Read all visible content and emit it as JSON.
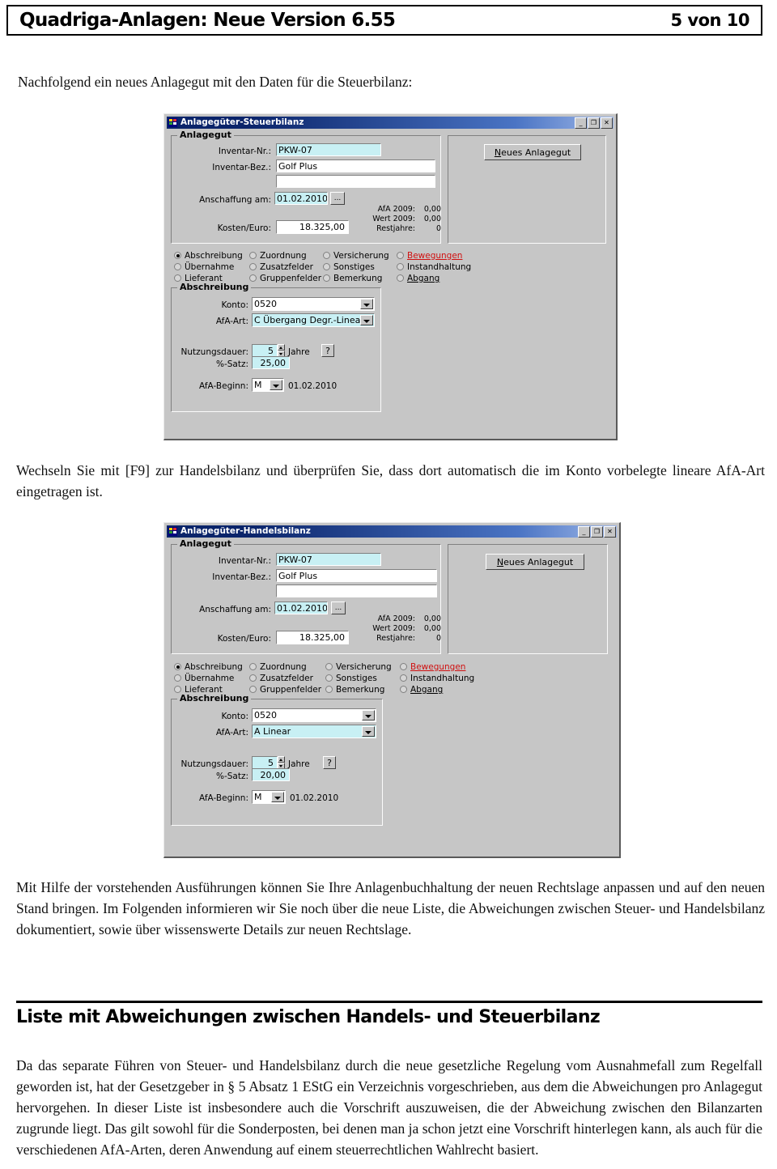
{
  "header": {
    "title": "Quadriga-Anlagen: Neue Version 6.55",
    "page_indicator": "5 von 10"
  },
  "body": {
    "lead_paragraph": "Nachfolgend ein neues Anlagegut mit den Daten für die Steuerbilanz:",
    "middle_paragraph": "Wechseln Sie mit [F9] zur Handelsbilanz und überprüfen Sie, dass dort automatisch die im Konto vorbelegte lineare AfA-Art eingetragen ist.",
    "after_second_paragraph": "Mit Hilfe der vorstehenden Ausführungen können Sie Ihre Anlagenbuchhaltung der neuen Rechtslage anpassen und auf den neuen Stand bringen. Im Folgenden informieren wir Sie noch über die neue Liste, die Abweichungen zwischen Steuer- und Handelsbilanz dokumentiert, sowie über wissenswerte Details zur neuen Rechtslage.",
    "section_heading": "Liste mit Abweichungen zwischen Handels- und Steuerbilanz",
    "last_paragraph": "Da das separate Führen von Steuer- und Handelsbilanz durch die neue gesetzliche Regelung vom Ausnahmefall zum Regelfall geworden ist, hat der Gesetzgeber in § 5 Absatz 1 EStG ein Verzeichnis vorgeschrieben, aus dem die Abweichungen pro Anlagegut hervorgehen. In dieser Liste ist insbesondere auch die Vorschrift auszuweisen, die der Abweichung zwischen den Bilanzarten zugrunde liegt. Das gilt sowohl für die Sonderposten, bei denen man ja schon jetzt eine Vorschrift hinterlegen kann, als auch für die verschiedenen AfA-Arten, deren Anwendung auf einem steuerrechtlichen Wahlrecht basiert."
  },
  "dialog_steuerbilanz": {
    "window_title": "Anlagegüter-Steuerbilanz",
    "titlebar_buttons": {
      "minimize": "_",
      "maximize": "❐",
      "close": "✕"
    },
    "new_asset_button": {
      "underlined": "N",
      "rest": "eues Anlagegut"
    },
    "group_anlagegut": "Anlagegut",
    "fields": {
      "inventar_nr_label": "Inventar-Nr.:",
      "inventar_nr_value": "PKW-07",
      "inventar_bez_label": "Inventar-Bez.:",
      "inventar_bez_value": "Golf Plus",
      "inventar_bez2_value": "",
      "anschaffung_label": "Anschaffung am:",
      "anschaffung_value": "01.02.2010",
      "browse_button": "...",
      "kosten_label": "Kosten/Euro:",
      "kosten_value": "18.325,00"
    },
    "stats": [
      {
        "key": "AfA 2009:",
        "value": "0,00"
      },
      {
        "key": "Wert 2009:",
        "value": "0,00"
      },
      {
        "key": "Restjahre:",
        "value": "0"
      }
    ],
    "radios": [
      {
        "label": "Abschreibung",
        "underline": "A",
        "selected": true,
        "red": false
      },
      {
        "label": "Übernahme",
        "underline": "b",
        "selected": false,
        "red": false
      },
      {
        "label": "Lieferant",
        "underline": "L",
        "selected": false,
        "red": false
      },
      {
        "label": "Zuordnung",
        "underline": "Z",
        "selected": false,
        "red": false
      },
      {
        "label": "Zusatzfelder",
        "underline": "",
        "selected": false,
        "red": false
      },
      {
        "label": "Gruppenfelder",
        "underline": "G",
        "selected": false,
        "red": false
      },
      {
        "label": "Versicherung",
        "underline": "V",
        "selected": false,
        "red": false
      },
      {
        "label": "Sonstiges",
        "underline": "S",
        "selected": false,
        "red": false
      },
      {
        "label": "Bemerkung",
        "underline": "",
        "selected": false,
        "red": false
      },
      {
        "label": "Bewegungen",
        "underline": "Bewegungen",
        "selected": false,
        "red": true
      },
      {
        "label": "Instandhaltung",
        "underline": "h",
        "selected": false,
        "red": false
      },
      {
        "label": "Abgang",
        "underline": "Abgang",
        "selected": false,
        "red": false
      }
    ],
    "group_abschreibung": "Abschreibung",
    "abschreibung": {
      "konto_label": "Konto:",
      "konto_value": "0520",
      "afa_art_label": "AfA-Art:",
      "afa_art_value": "C Übergang Degr.-Linear",
      "nutzungsdauer_label": "Nutzungsdauer:",
      "nutzungsdauer_value": "5",
      "jahre_label": "Jahre",
      "help_button": "?",
      "satz_label": "%-Satz:",
      "satz_value": "25,00",
      "afa_beginn_label": "AfA-Beginn:",
      "afa_beginn_value": "M",
      "afa_beginn_date": "01.02.2010"
    }
  },
  "dialog_handelsbilanz": {
    "window_title": "Anlagegüter-Handelsbilanz",
    "titlebar_buttons": {
      "minimize": "_",
      "maximize": "❐",
      "close": "✕"
    },
    "new_asset_button": {
      "underlined": "N",
      "rest": "eues Anlagegut"
    },
    "group_anlagegut": "Anlagegut",
    "fields": {
      "inventar_nr_label": "Inventar-Nr.:",
      "inventar_nr_value": "PKW-07",
      "inventar_bez_label": "Inventar-Bez.:",
      "inventar_bez_value": "Golf Plus",
      "inventar_bez2_value": "",
      "anschaffung_label": "Anschaffung am:",
      "anschaffung_value": "01.02.2010",
      "browse_button": "...",
      "kosten_label": "Kosten/Euro:",
      "kosten_value": "18.325,00"
    },
    "stats": [
      {
        "key": "AfA 2009:",
        "value": "0,00"
      },
      {
        "key": "Wert 2009:",
        "value": "0,00"
      },
      {
        "key": "Restjahre:",
        "value": "0"
      }
    ],
    "radios": [
      {
        "label": "Abschreibung",
        "underline": "A",
        "selected": true,
        "red": false
      },
      {
        "label": "Übernahme",
        "underline": "b",
        "selected": false,
        "red": false
      },
      {
        "label": "Lieferant",
        "underline": "L",
        "selected": false,
        "red": false
      },
      {
        "label": "Zuordnung",
        "underline": "Z",
        "selected": false,
        "red": false
      },
      {
        "label": "Zusatzfelder",
        "underline": "",
        "selected": false,
        "red": false
      },
      {
        "label": "Gruppenfelder",
        "underline": "G",
        "selected": false,
        "red": false
      },
      {
        "label": "Versicherung",
        "underline": "V",
        "selected": false,
        "red": false
      },
      {
        "label": "Sonstiges",
        "underline": "S",
        "selected": false,
        "red": false
      },
      {
        "label": "Bemerkung",
        "underline": "",
        "selected": false,
        "red": false
      },
      {
        "label": "Bewegungen",
        "underline": "Bewegungen",
        "selected": false,
        "red": true
      },
      {
        "label": "Instandhaltung",
        "underline": "h",
        "selected": false,
        "red": false
      },
      {
        "label": "Abgang",
        "underline": "Abgang",
        "selected": false,
        "red": false
      }
    ],
    "group_abschreibung": "Abschreibung",
    "abschreibung": {
      "konto_label": "Konto:",
      "konto_value": "0520",
      "afa_art_label": "AfA-Art:",
      "afa_art_value": "A Linear",
      "nutzungsdauer_label": "Nutzungsdauer:",
      "nutzungsdauer_value": "5",
      "jahre_label": "Jahre",
      "help_button": "?",
      "satz_label": "%-Satz:",
      "satz_value": "20,00",
      "afa_beginn_label": "AfA-Beginn:",
      "afa_beginn_value": "M",
      "afa_beginn_date": "01.02.2010"
    }
  },
  "colors": {
    "titlebar_start": "#0a246a",
    "titlebar_end": "#9fb8e8",
    "dialog_face": "#c6c6c6",
    "focus_field": "#c8f0f4",
    "alert_red": "#d01010"
  }
}
